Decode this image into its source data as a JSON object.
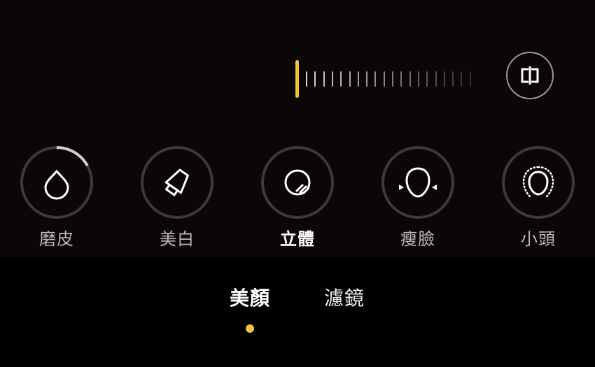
{
  "slider": {
    "value_percent": 0,
    "tick_count": 21,
    "accent_color": "#f2c53d"
  },
  "compare_button": {
    "icon": "compare-split-icon"
  },
  "tools": [
    {
      "label": "磨皮",
      "icon": "droplet-icon",
      "active": false,
      "level_percent": 17
    },
    {
      "label": "美白",
      "icon": "whitening-bottle-icon",
      "active": false,
      "level_percent": 0
    },
    {
      "label": "立體",
      "icon": "contour-shading-icon",
      "active": true,
      "level_percent": 0
    },
    {
      "label": "瘦臉",
      "icon": "slim-face-icon",
      "active": false,
      "level_percent": 0
    },
    {
      "label": "小頭",
      "icon": "small-head-icon",
      "active": false,
      "level_percent": 0
    }
  ],
  "tabs": [
    {
      "label": "美顏",
      "active": true
    },
    {
      "label": "濾鏡",
      "active": false
    }
  ],
  "colors": {
    "accent": "#f2c53d",
    "ring": "#3a3a3a",
    "ring_progress": "#cfcfcf"
  }
}
